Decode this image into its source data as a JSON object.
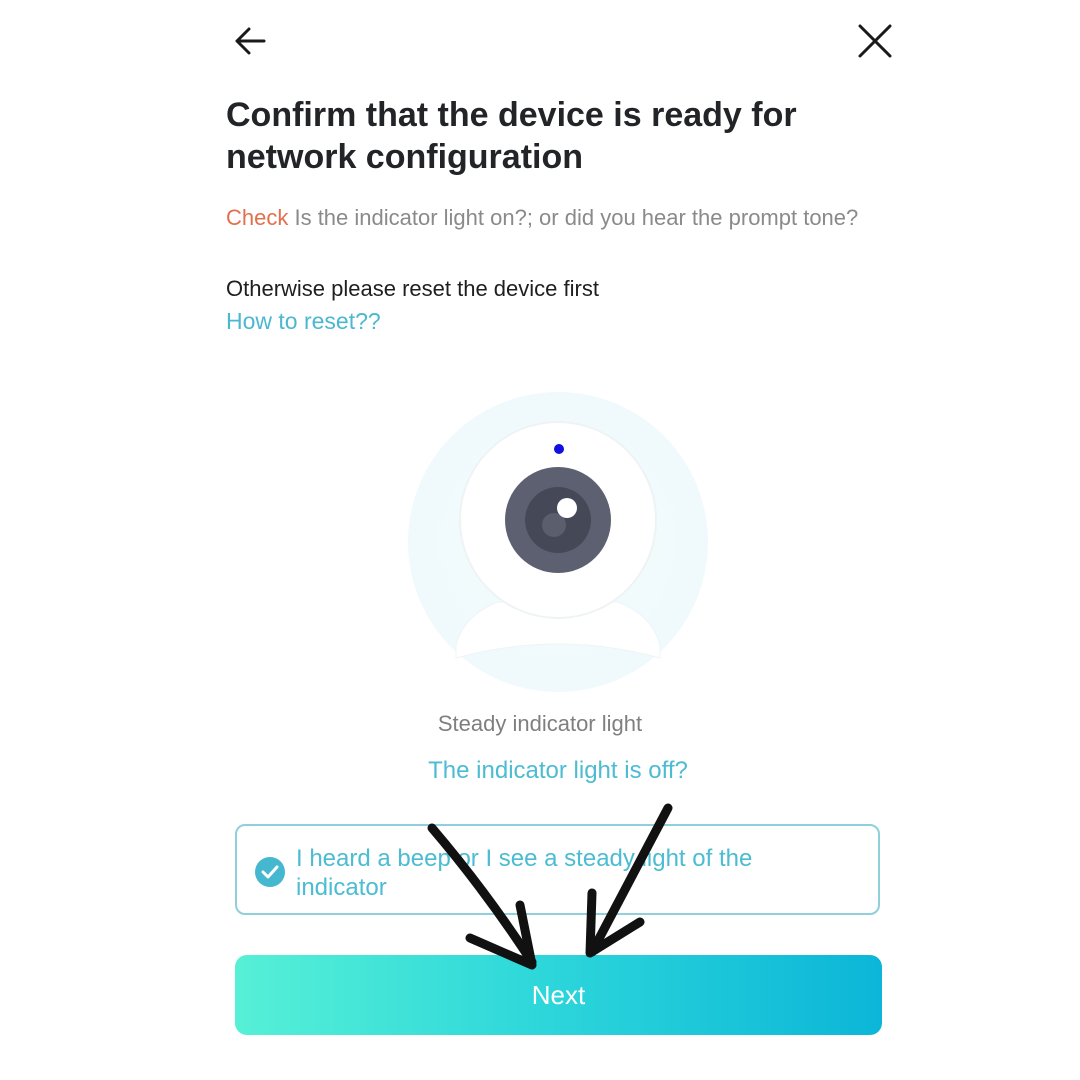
{
  "header": {
    "back_icon": "arrow-left-icon",
    "close_icon": "close-icon",
    "title": "Confirm that the device is ready for network configuration"
  },
  "instructions": {
    "check_word": "Check",
    "check_text": " Is the indicator light on?; or did you hear the prompt tone?",
    "otherwise": "Otherwise please reset the device first",
    "reset_link": "How to reset??"
  },
  "illustration": {
    "icon": "camera-icon",
    "indicator_color": "#1010e0",
    "caption": "Steady indicator light",
    "help_link": "The indicator light is off?"
  },
  "confirm": {
    "checked": true,
    "label": "I heard a beep or I see a steady light of the indicator"
  },
  "next_button": {
    "label": "Next"
  },
  "colors": {
    "accent": "#4cbcd2",
    "warning": "#e2704f",
    "button_gradient_start": "#56f0d6",
    "button_gradient_end": "#0bb6d8"
  }
}
